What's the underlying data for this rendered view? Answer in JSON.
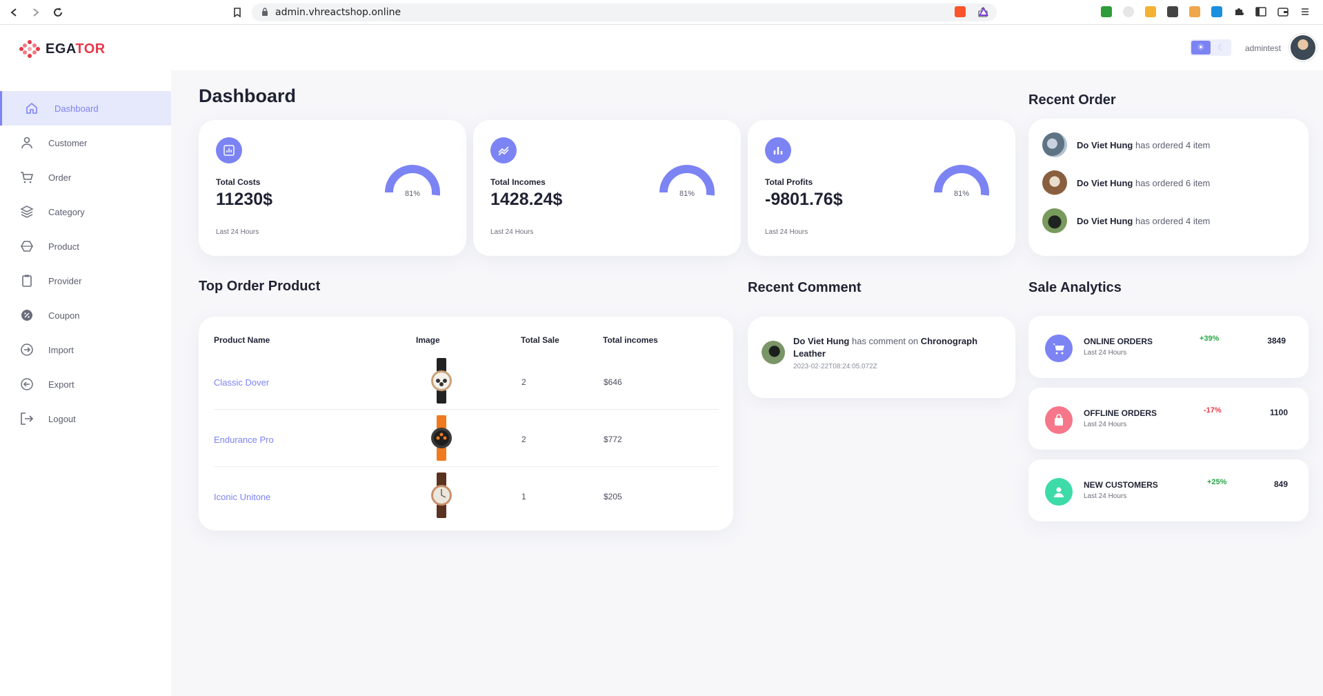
{
  "browser": {
    "url": "admin.vhreactshop.online"
  },
  "header": {
    "logo_text_left": "EGA",
    "logo_text_right": "TOR",
    "username": "admintest"
  },
  "sidebar": {
    "items": [
      {
        "label": "Dashboard",
        "icon": "home-icon",
        "active": true
      },
      {
        "label": "Customer",
        "icon": "user-icon"
      },
      {
        "label": "Order",
        "icon": "cart-icon"
      },
      {
        "label": "Category",
        "icon": "layers-icon"
      },
      {
        "label": "Product",
        "icon": "hexagon-icon"
      },
      {
        "label": "Provider",
        "icon": "clipboard-icon"
      },
      {
        "label": "Coupon",
        "icon": "coupon-icon"
      },
      {
        "label": "Import",
        "icon": "import-icon"
      },
      {
        "label": "Export",
        "icon": "export-icon"
      },
      {
        "label": "Logout",
        "icon": "logout-icon"
      }
    ]
  },
  "main": {
    "title": "Dashboard",
    "stats": [
      {
        "label": "Total Costs",
        "value": "11230$",
        "sub": "Last 24 Hours",
        "percent": "81%",
        "fraction": 0.81,
        "icon": "chart-box-icon"
      },
      {
        "label": "Total Incomes",
        "value": "1428.24$",
        "sub": "Last 24 Hours",
        "percent": "81%",
        "fraction": 0.81,
        "icon": "trend-icon"
      },
      {
        "label": "Total Profits",
        "value": "-9801.76$",
        "sub": "Last 24 Hours",
        "percent": "81%",
        "fraction": 0.81,
        "icon": "bar-chart-icon"
      }
    ],
    "top_order": {
      "title": "Top Order Product",
      "headers": [
        "Product Name",
        "Image",
        "Total Sale",
        "Total incomes"
      ],
      "rows": [
        {
          "name": "Classic Dover",
          "sale": "2",
          "income": "$646",
          "strap": "#222222"
        },
        {
          "name": "Endurance Pro",
          "sale": "2",
          "income": "$772",
          "strap": "#f07a1e"
        },
        {
          "name": "Iconic Unitone",
          "sale": "1",
          "income": "$205",
          "strap": "#5a3220"
        }
      ]
    },
    "recent_comment": {
      "title": "Recent Comment",
      "author": "Do Viet Hung",
      "middle": " has comment on ",
      "product": "Chronograph Leather",
      "time": "2023-02-22T08:24:05.072Z"
    }
  },
  "right": {
    "recent_order": {
      "title": "Recent Order",
      "items": [
        {
          "name": "Do Viet Hung",
          "text": " has ordered 4 item"
        },
        {
          "name": "Do Viet Hung",
          "text": " has ordered 6 item"
        },
        {
          "name": "Do Viet Hung",
          "text": " has ordered 4 item"
        }
      ]
    },
    "sale_analytics": {
      "title": "Sale Analytics",
      "items": [
        {
          "title": "ONLINE ORDERS",
          "sub": "Last 24 Hours",
          "pct": "+39%",
          "num": "3849",
          "color": "#7c83f3",
          "pct_color": "#27a745",
          "icon": "cart-icon"
        },
        {
          "title": "OFFLINE ORDERS",
          "sub": "Last 24 Hours",
          "pct": "-17%",
          "num": "1100",
          "color": "#f7778a",
          "pct_color": "#e6394a",
          "icon": "bag-icon"
        },
        {
          "title": "NEW CUSTOMERS",
          "sub": "Last 24 Hours",
          "pct": "+25%",
          "num": "849",
          "color": "#3ddba8",
          "pct_color": "#27a745",
          "icon": "person-icon"
        }
      ]
    }
  }
}
